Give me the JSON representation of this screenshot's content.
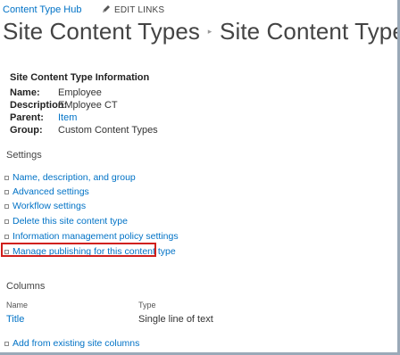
{
  "breadcrumb": {
    "hub_link": "Content Type Hub",
    "edit_links": "EDIT LINKS"
  },
  "title": {
    "part1": "Site Content Types",
    "separator": "▸",
    "part2": "Site Content Type"
  },
  "info": {
    "heading": "Site Content Type Information",
    "rows": [
      {
        "key": "Name:",
        "value": "Employee"
      },
      {
        "key": "Description:",
        "value": "EMployee CT"
      },
      {
        "key": "Parent:",
        "value": "Item"
      },
      {
        "key": "Group:",
        "value": "Custom Content Types"
      }
    ]
  },
  "settings": {
    "heading": "Settings",
    "links": [
      "Name, description, and group",
      "Advanced settings",
      "Workflow settings",
      "Delete this site content type",
      "Information management policy settings",
      "Manage publishing for this content type"
    ]
  },
  "columns": {
    "heading": "Columns",
    "headers": [
      "Name",
      "Type"
    ],
    "rows": [
      {
        "name": "Title",
        "type": "Single line of text"
      }
    ],
    "add_link": "Add from existing site columns"
  },
  "colors": {
    "link": "#0072c6",
    "highlight": "#d0201c"
  }
}
